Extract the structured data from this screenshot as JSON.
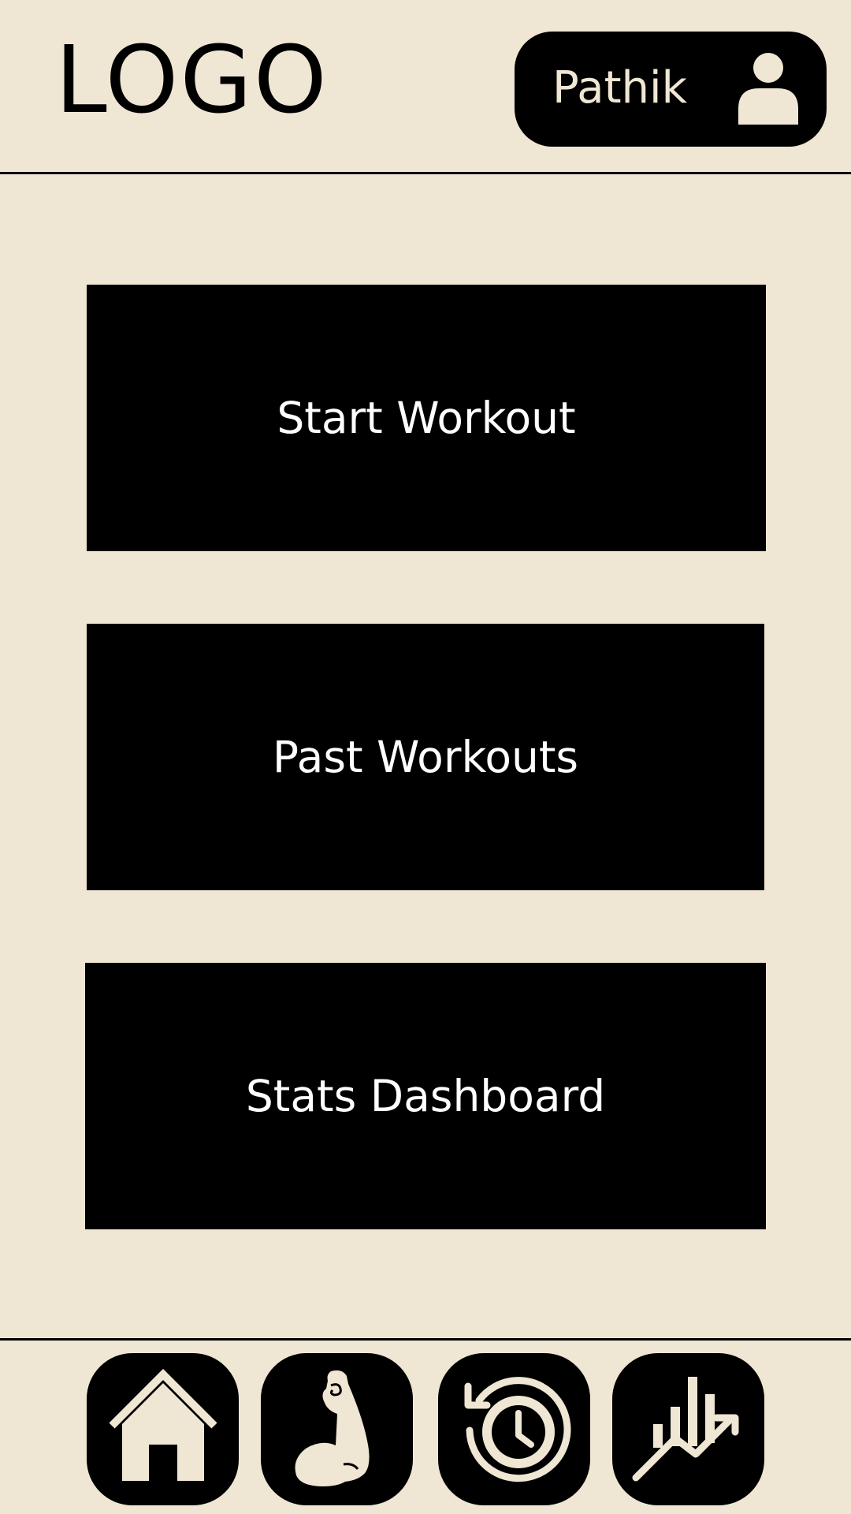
{
  "header": {
    "logo_text": "LOGO",
    "user_name": "Pathik",
    "user_icon": "user-icon"
  },
  "menu": {
    "start_workout": "Start Workout",
    "past_workouts": "Past Workouts",
    "stats_dashboard": "Stats Dashboard"
  },
  "bottom_nav": {
    "items": [
      {
        "icon": "home-icon"
      },
      {
        "icon": "flexed-bicep-icon"
      },
      {
        "icon": "history-clock-icon"
      },
      {
        "icon": "stats-chart-icon"
      }
    ]
  },
  "colors": {
    "background": "#EFE6D3",
    "foreground": "#000000",
    "button_text": "#FFFFFF"
  }
}
